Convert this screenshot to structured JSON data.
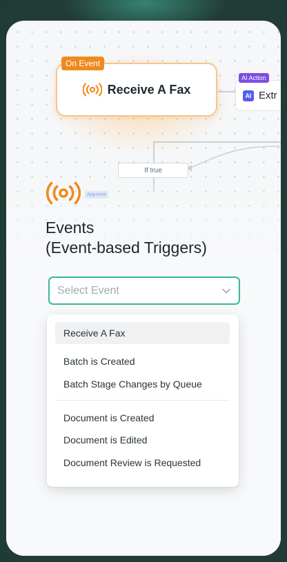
{
  "workflow": {
    "event_node": {
      "badge": "On Event",
      "title": "Receive A Fax",
      "icon": "broadcast-icon"
    },
    "ai_node": {
      "badge": "AI Action",
      "icon_text": "AI",
      "title": "Extr"
    },
    "condition_label": "If true",
    "approval_chip": "Approval"
  },
  "events_panel": {
    "title_line1": "Events",
    "title_line2": "(Event-based Triggers)",
    "select": {
      "placeholder": "Select Event"
    },
    "options": [
      "Receive A Fax",
      "Batch is Created",
      "Batch Stage Changes by Queue",
      "Document is Created",
      "Document is Edited",
      "Document Review is Requested"
    ],
    "selected_option": "Receive A Fax"
  },
  "colors": {
    "accent_orange": "#ef8a1f",
    "accent_teal": "#35b79a",
    "ai_purple": "#7d4ce6",
    "frame_green": "#213c36"
  }
}
